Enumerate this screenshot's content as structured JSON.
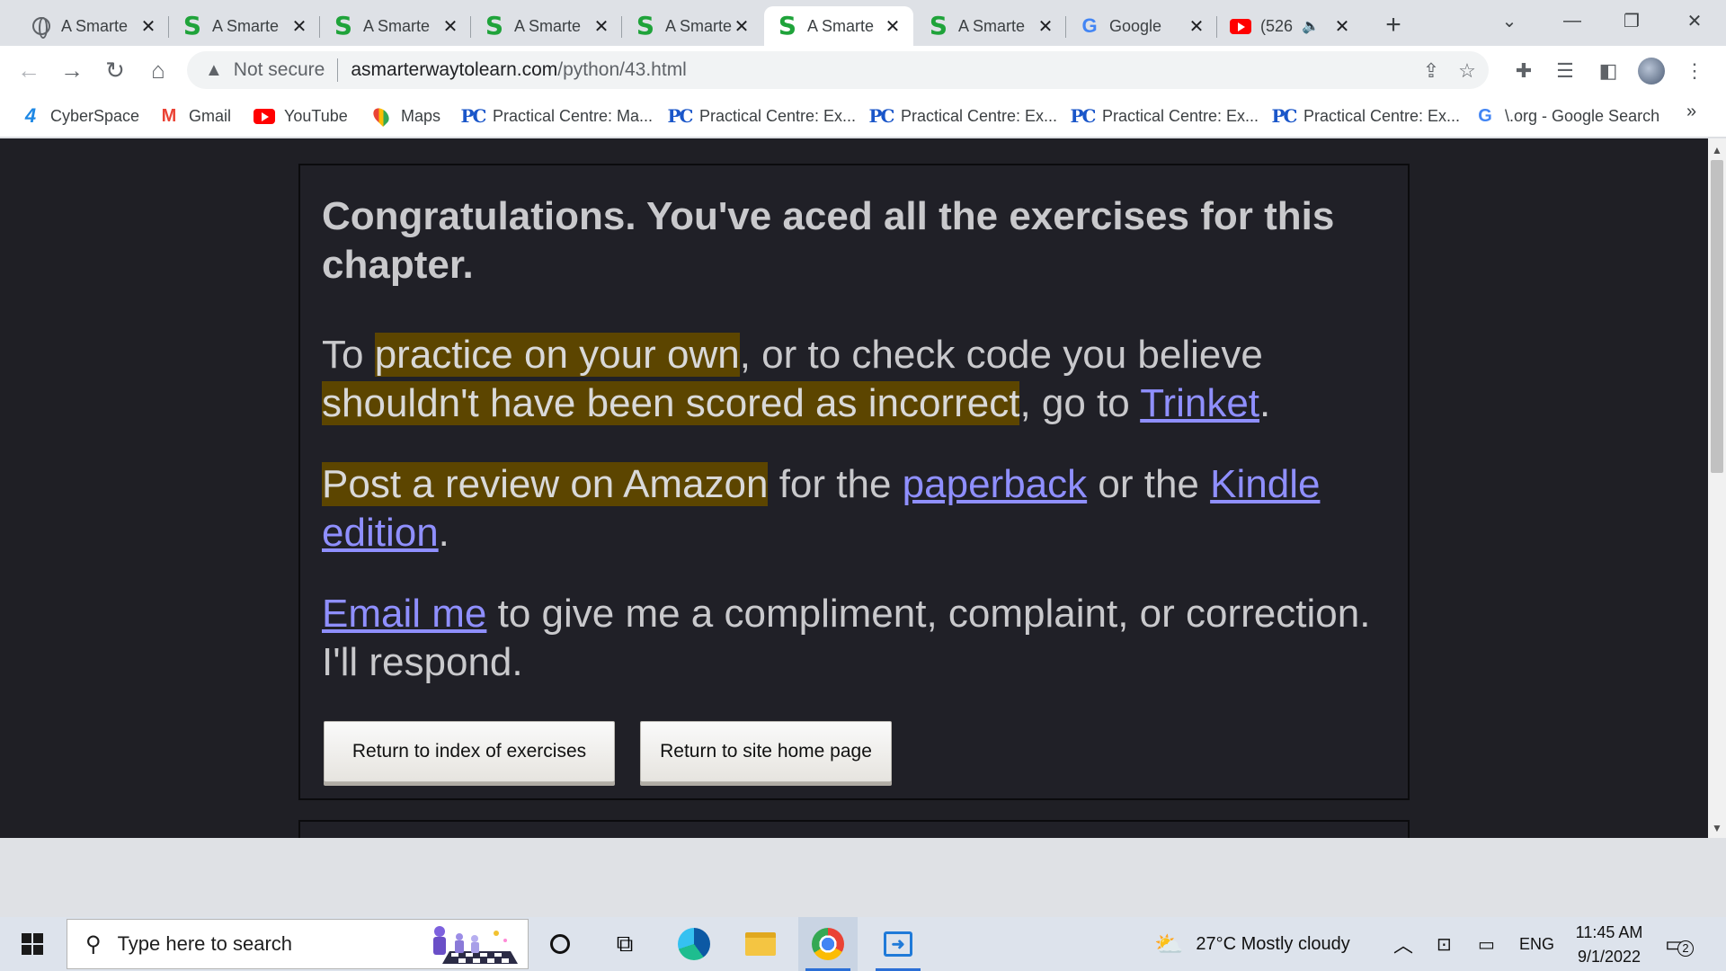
{
  "browser": {
    "tabs": [
      {
        "title": "A Smarte",
        "icon": "globe-icon"
      },
      {
        "title": "A Smarte",
        "icon": "s-logo-icon"
      },
      {
        "title": "A Smarte",
        "icon": "s-logo-icon"
      },
      {
        "title": "A Smarte",
        "icon": "s-logo-icon"
      },
      {
        "title": "A Smarte",
        "icon": "s-logo-icon"
      },
      {
        "title": "A Smarte",
        "icon": "s-logo-icon",
        "active": true
      },
      {
        "title": "A Smarte",
        "icon": "s-logo-icon"
      },
      {
        "title": "Google",
        "icon": "google-icon"
      },
      {
        "title": "(526",
        "icon": "youtube-icon",
        "audio": true
      }
    ],
    "tab_logo_s": "S",
    "tab_logo_g": "G",
    "url": {
      "security_label": "Not secure",
      "host": "asmarterwaytolearn.com",
      "path": "/python/43.html"
    },
    "bookmarks": [
      {
        "label": "CyberSpace",
        "icon": "cyberspace-icon"
      },
      {
        "label": "Gmail",
        "icon": "gmail-icon"
      },
      {
        "label": "YouTube",
        "icon": "youtube-icon"
      },
      {
        "label": "Maps",
        "icon": "maps-icon"
      },
      {
        "label": "Practical Centre: Ma...",
        "icon": "pc-icon"
      },
      {
        "label": "Practical Centre: Ex...",
        "icon": "pc-icon"
      },
      {
        "label": "Practical Centre: Ex...",
        "icon": "pc-icon"
      },
      {
        "label": "Practical Centre: Ex...",
        "icon": "pc-icon"
      },
      {
        "label": "Practical Centre: Ex...",
        "icon": "pc-icon"
      },
      {
        "label": "\\.org - Google Search",
        "icon": "google-icon"
      }
    ],
    "bookmark_logo_cs": "4",
    "bookmark_logo_gmail": "M",
    "bookmark_logo_pc": "PC",
    "bookmark_logo_g": "G"
  },
  "content": {
    "heading": "Congratulations. You've aced all the exercises for this chapter.",
    "para1": {
      "t1": "To ",
      "hl1": "practice on your own",
      "t2": ", or to check code you believe ",
      "hl2": "shouldn't have been scored as incorrect",
      "t3": ", go to ",
      "link": "Trinket",
      "t4": "."
    },
    "para2": {
      "hl": "Post a review on Amazon",
      "t1": " for the ",
      "link1": "paperback",
      "t2": " or the ",
      "link2": "Kindle edition",
      "t3": "."
    },
    "para3": {
      "link": "Email me",
      "text": " to give me a compliment, complaint, or correction. I'll respond."
    },
    "buttons": {
      "index": "Return to index of exercises",
      "home": "Return to site home page"
    }
  },
  "colors": {
    "page_bg": "#1f1f25",
    "highlight": "#5c4500",
    "link": "#8f8fff",
    "text": "#c9c9cc"
  },
  "taskbar": {
    "search_placeholder": "Type here to search",
    "weather": "27°C  Mostly cloudy",
    "language": "ENG",
    "time": "11:45 AM",
    "date": "9/1/2022",
    "notifications": "2"
  }
}
